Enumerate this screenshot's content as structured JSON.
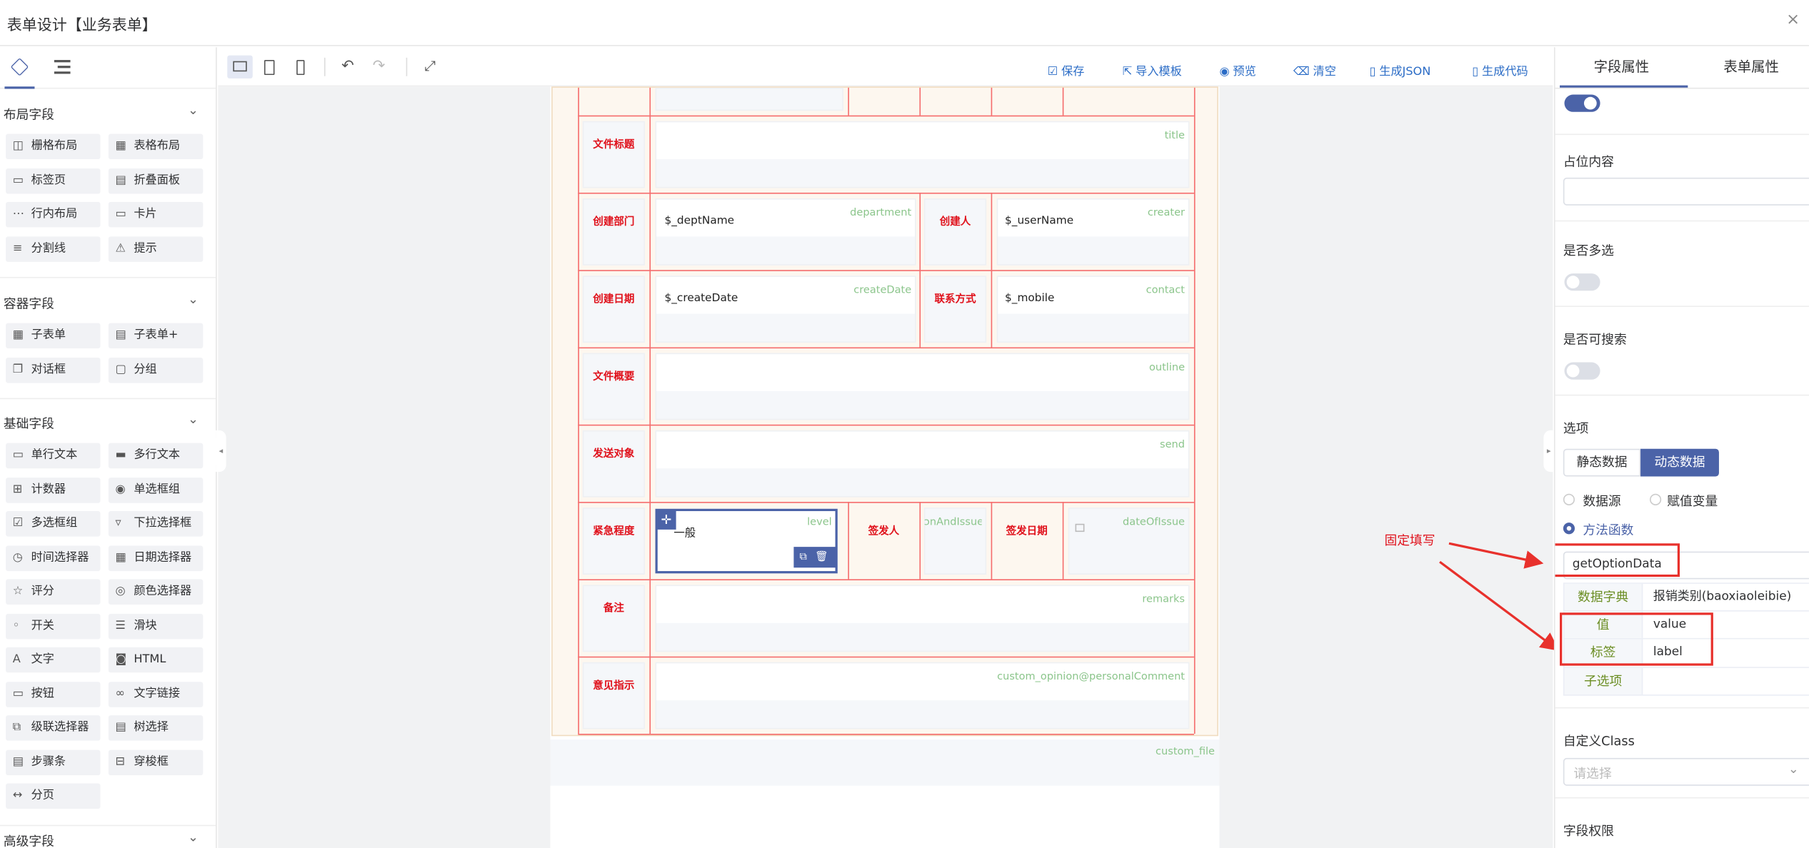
{
  "window": {
    "title": "表单设计【业务表单】",
    "close": "×"
  },
  "left": {
    "tabs": [
      {
        "icon": "cube-icon"
      },
      {
        "icon": "outline-icon"
      }
    ],
    "sections": [
      {
        "title": "布局字段",
        "items": [
          {
            "label": "栅格布局",
            "icon": "◫"
          },
          {
            "label": "表格布局",
            "icon": "▦"
          },
          {
            "label": "标签页",
            "icon": "▭"
          },
          {
            "label": "折叠面板",
            "icon": "▤"
          },
          {
            "label": "行内布局",
            "icon": "⋯"
          },
          {
            "label": "卡片",
            "icon": "▭"
          },
          {
            "label": "分割线",
            "icon": "≡"
          },
          {
            "label": "提示",
            "icon": "⚠"
          }
        ]
      },
      {
        "title": "容器字段",
        "items": [
          {
            "label": "子表单",
            "icon": "▦"
          },
          {
            "label": "子表单+",
            "icon": "▤"
          },
          {
            "label": "对话框",
            "icon": "❐"
          },
          {
            "label": "分组",
            "icon": "▢"
          }
        ]
      },
      {
        "title": "基础字段",
        "items": [
          {
            "label": "单行文本",
            "icon": "▭"
          },
          {
            "label": "多行文本",
            "icon": "▬"
          },
          {
            "label": "计数器",
            "icon": "⊞"
          },
          {
            "label": "单选框组",
            "icon": "◉"
          },
          {
            "label": "多选框组",
            "icon": "☑"
          },
          {
            "label": "下拉选择框",
            "icon": "▿"
          },
          {
            "label": "时间选择器",
            "icon": "◷"
          },
          {
            "label": "日期选择器",
            "icon": "▦"
          },
          {
            "label": "评分",
            "icon": "☆"
          },
          {
            "label": "颜色选择器",
            "icon": "◎"
          },
          {
            "label": "开关",
            "icon": "◦"
          },
          {
            "label": "滑块",
            "icon": "☰"
          },
          {
            "label": "文字",
            "icon": "A"
          },
          {
            "label": "HTML",
            "icon": "◙"
          },
          {
            "label": "按钮",
            "icon": "▭"
          },
          {
            "label": "文字链接",
            "icon": "∞"
          },
          {
            "label": "级联选择器",
            "icon": "⧉"
          },
          {
            "label": "树选择",
            "icon": "▤"
          },
          {
            "label": "步骤条",
            "icon": "▤"
          },
          {
            "label": "穿梭框",
            "icon": "⊟"
          },
          {
            "label": "分页",
            "icon": "↔"
          }
        ]
      },
      {
        "title": "高级字段",
        "items": []
      }
    ],
    "chevron": "⌄"
  },
  "toolbar": {
    "devices": [
      {
        "icon": "desktop-icon"
      },
      {
        "icon": "tablet-icon"
      },
      {
        "icon": "phone-icon"
      }
    ],
    "actions": [
      {
        "label": "保存",
        "icon": "☑"
      },
      {
        "label": "导入模板",
        "icon": "⇱"
      },
      {
        "label": "预览",
        "icon": "◉"
      },
      {
        "label": "清空",
        "icon": "⌫"
      },
      {
        "label": "生成JSON",
        "icon": "▯"
      },
      {
        "label": "生成代码",
        "icon": "▯"
      }
    ]
  },
  "form": {
    "rows": [
      {
        "label": "文件标题",
        "field": "title"
      },
      {
        "label": "创建部门",
        "value": "$_deptName",
        "field": "department",
        "label2": "创建人",
        "value2": "$_userName",
        "field2": "creater"
      },
      {
        "label": "创建日期",
        "value": "$_createDate",
        "field": "createDate",
        "label2": "联系方式",
        "value2": "$_mobile",
        "field2": "contact"
      },
      {
        "label": "文件概要",
        "field": "outline"
      },
      {
        "label": "发送对象",
        "field": "send"
      },
      {
        "label": "紧急程度",
        "value": "一般",
        "field": "level",
        "label2": "签发人",
        "field2": "ɔnAndIssue",
        "label3": "签发日期",
        "field3": "dateOfIssue"
      },
      {
        "label": "备注",
        "field": "remarks"
      },
      {
        "label": "意见指示",
        "field": "custom_opinion@personalComment"
      }
    ],
    "extra_field": "custom_file"
  },
  "annotation": {
    "text": "固定填写"
  },
  "right": {
    "tabs": {
      "field": "字段属性",
      "form": "表单属性"
    },
    "placeholder_label": "占位内容",
    "multiple_label": "是否多选",
    "searchable_label": "是否可搜索",
    "options_label": "选项",
    "static_btn": "静态数据",
    "dynamic_btn": "动态数据",
    "radio": {
      "datasource": "数据源",
      "assign": "赋值变量",
      "method": "方法函数"
    },
    "method_value": "getOptionData",
    "table": [
      {
        "k": "数据字典",
        "v": "报销类别(baoxiaoleibie)"
      },
      {
        "k": "值",
        "v": "value"
      },
      {
        "k": "标签",
        "v": "label"
      },
      {
        "k": "子选项",
        "v": ""
      }
    ],
    "class_label": "自定义Class",
    "class_placeholder": "请选择",
    "perm_label": "字段权限"
  },
  "colors": {
    "accent": "#4b63a8",
    "red": "#e0131d",
    "fieldname": "#8bc58b",
    "canvas": "#f1f2f3"
  }
}
